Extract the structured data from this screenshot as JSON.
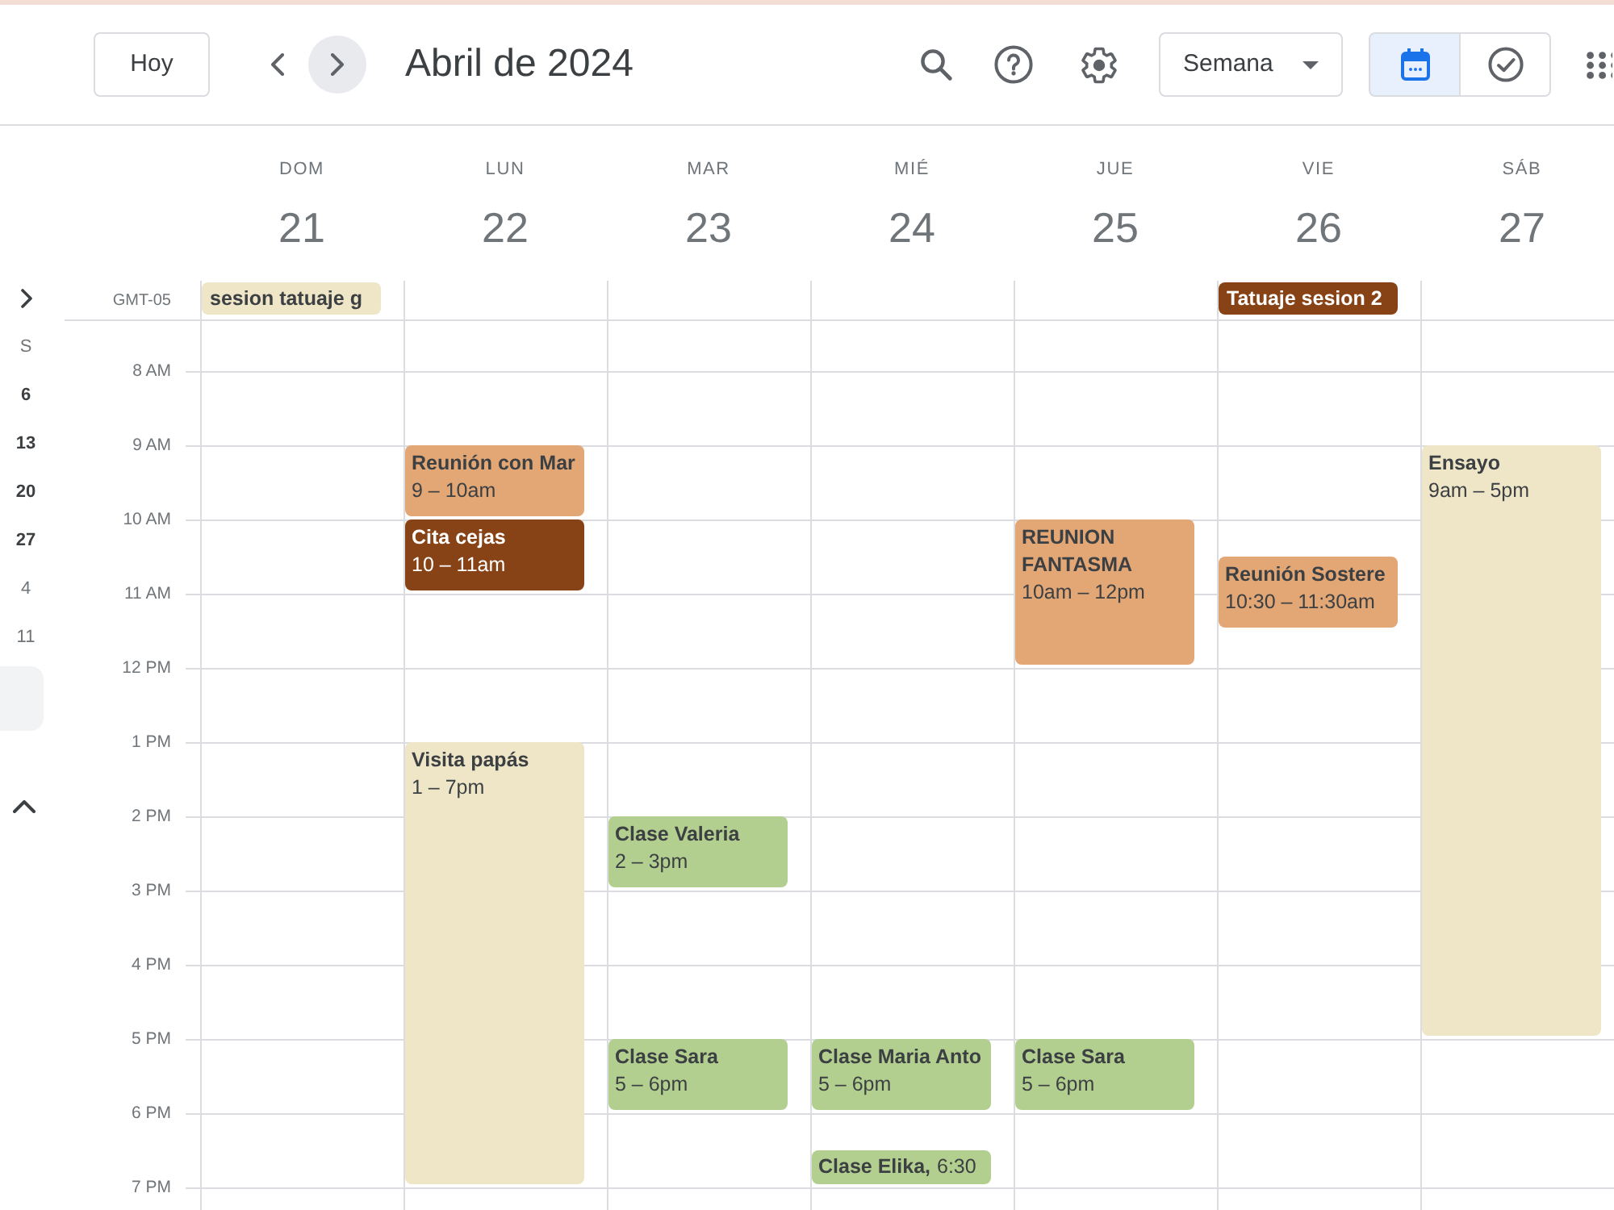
{
  "header": {
    "today_button": "Hoy",
    "nav_buttons": [
      {
        "kind": "prev",
        "hovered": false
      },
      {
        "kind": "next",
        "hovered": true
      }
    ],
    "title": "Abril de 2024",
    "view_select": "Semana",
    "view_toggle": [
      {
        "kind": "calendar",
        "selected": true
      },
      {
        "kind": "tasks",
        "selected": false
      }
    ]
  },
  "mini_calendar": {
    "weekday": "S",
    "days": [
      {
        "label": "6",
        "other_month": false
      },
      {
        "label": "13",
        "other_month": false
      },
      {
        "label": "20",
        "other_month": false
      },
      {
        "label": "27",
        "other_month": false
      },
      {
        "label": "4",
        "other_month": true
      },
      {
        "label": "11",
        "other_month": true
      }
    ]
  },
  "timezone": "GMT-05",
  "days": [
    {
      "name": "DOM",
      "number": "21",
      "all_day": [
        {
          "title": "sesion tatuaje g",
          "color": "#efe6c8"
        }
      ]
    },
    {
      "name": "LUN",
      "number": "22",
      "events": [
        {
          "title": "Reunión con Mar",
          "time": "9 – 10am",
          "color": "#e3a675"
        },
        {
          "title": "Cita cejas",
          "time": "10 – 11am",
          "color": "#874316"
        },
        {
          "title": "Visita papás",
          "time": "1 – 7pm",
          "color": "#efe6c8"
        }
      ]
    },
    {
      "name": "MAR",
      "number": "23",
      "events": [
        {
          "title": "Clase Valeria",
          "time": "2 – 3pm",
          "color": "#b3cf8f"
        },
        {
          "title": "Clase Sara",
          "time": "5 – 6pm",
          "color": "#b3cf8f"
        }
      ]
    },
    {
      "name": "MIÉ",
      "number": "24",
      "events": [
        {
          "title": "Clase Maria Anto",
          "time": "5 – 6pm",
          "color": "#b3cf8f"
        },
        {
          "title": "Clase Elika,",
          "time": "6:30",
          "color": "#b3cf8f"
        }
      ]
    },
    {
      "name": "JUE",
      "number": "25",
      "events": [
        {
          "title": "REUNION FANTASMA",
          "time": "10am – 12pm",
          "color": "#e3a675"
        },
        {
          "title": "Clase Sara",
          "time": "5 – 6pm",
          "color": "#b3cf8f"
        }
      ]
    },
    {
      "name": "VIE",
      "number": "26",
      "all_day": [
        {
          "title": "Tatuaje sesion 2",
          "color": "#874316"
        }
      ],
      "events": [
        {
          "title": "Reunión Sostere",
          "time": "10:30 – 11:30am",
          "color": "#e3a675"
        }
      ]
    },
    {
      "name": "SÁB",
      "number": "27",
      "events": [
        {
          "title": "Ensayo",
          "time": "9am – 5pm",
          "color": "#efe6c8"
        }
      ]
    }
  ],
  "hours": [
    "8 AM",
    "9 AM",
    "10 AM",
    "11 AM",
    "12 PM",
    "1 PM",
    "2 PM",
    "3 PM",
    "4 PM",
    "5 PM",
    "6 PM",
    "7 PM"
  ]
}
